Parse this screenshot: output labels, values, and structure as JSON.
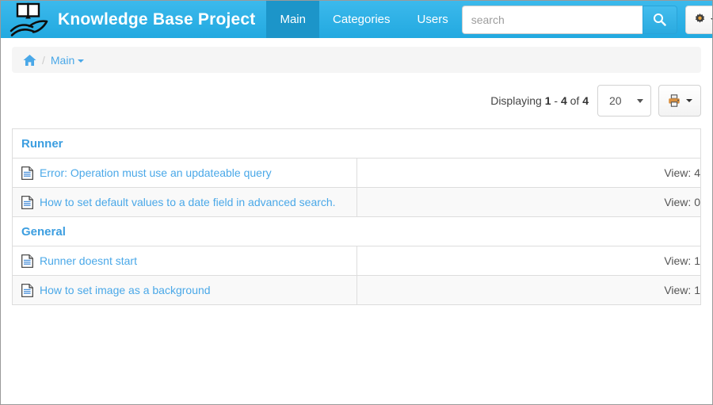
{
  "header": {
    "logo_icon": "open-book-hand-icon",
    "brand": "Knowledge Base Project",
    "nav": [
      {
        "label": "Main",
        "active": true
      },
      {
        "label": "Categories",
        "active": false
      },
      {
        "label": "Users",
        "active": false
      }
    ],
    "search": {
      "value": "",
      "placeholder": "search",
      "button_icon": "search-icon"
    },
    "settings": {
      "icon": "gear-icon",
      "caret": "▾"
    },
    "colors": {
      "navbar_bg": "#31b0e8",
      "navbar_active": "#1c95c9",
      "link": "#4aa8e8"
    }
  },
  "breadcrumb": {
    "home_icon": "home-icon",
    "separator": "/",
    "current": "Main"
  },
  "toolbar": {
    "displaying_prefix": "Displaying",
    "range_start": "1",
    "range_dash": "-",
    "range_end": "4",
    "of_label": "of",
    "total": "4",
    "page_size": "20",
    "page_size_options": [
      "20"
    ],
    "print_icon": "printer-icon",
    "print_caret": "▾"
  },
  "table": {
    "groups": [
      {
        "title": "Runner",
        "items": [
          {
            "icon": "document-icon",
            "title": "Error: Operation must use an updateable query",
            "views_label": "View: 4"
          },
          {
            "icon": "document-icon",
            "title": "How to set default values to a date field in advanced search.",
            "views_label": "View: 0"
          }
        ]
      },
      {
        "title": "General",
        "items": [
          {
            "icon": "document-icon",
            "title": "Runner doesnt start",
            "views_label": "View: 1"
          },
          {
            "icon": "document-icon",
            "title": "How to set image as a background",
            "views_label": "View: 1"
          }
        ]
      }
    ]
  }
}
